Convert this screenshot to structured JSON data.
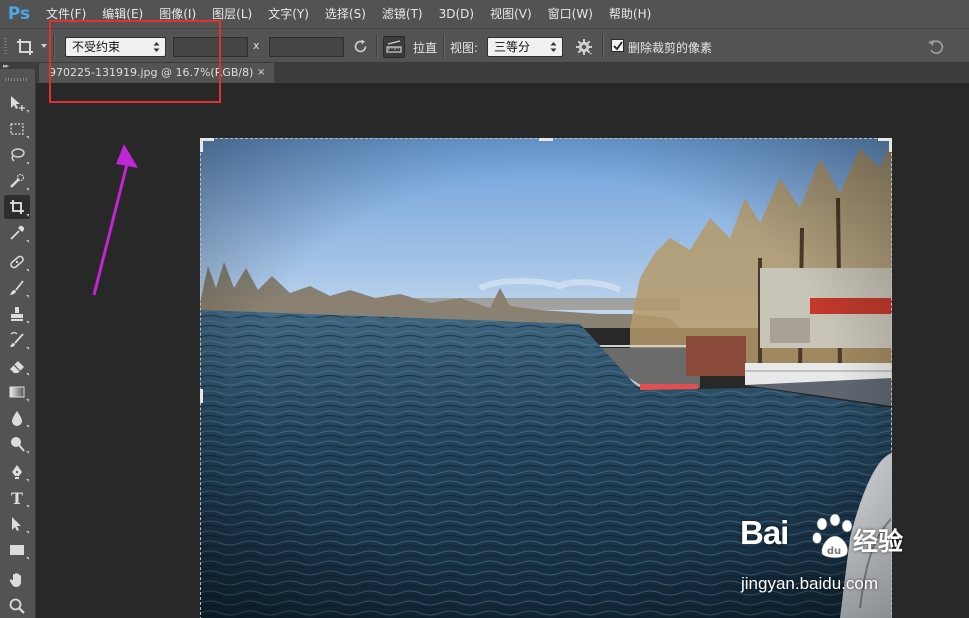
{
  "app": {
    "logo": "Ps"
  },
  "menu": [
    "文件(F)",
    "编辑(E)",
    "图像(I)",
    "图层(L)",
    "文字(Y)",
    "选择(S)",
    "滤镜(T)",
    "3D(D)",
    "视图(V)",
    "窗口(W)",
    "帮助(H)"
  ],
  "options": {
    "ratio_preset": "不受约束",
    "width_value": "",
    "height_value": "",
    "x_separator": "x",
    "straighten_label": "拉直",
    "view_label": "视图:",
    "view_preset": "三等分",
    "delete_cropped_label": "删除裁剪的像素",
    "delete_cropped_checked": true
  },
  "document_tab": {
    "title": "970225-131919.jpg @ 16.7%(RGB/8)",
    "close": "×"
  },
  "tools": [
    "move-tool",
    "marquee-tool",
    "lasso-tool",
    "quick-selection-tool",
    "crop-tool",
    "eyedropper-tool",
    "spot-healing-tool",
    "brush-tool",
    "clone-stamp-tool",
    "history-brush-tool",
    "eraser-tool",
    "gradient-tool",
    "blur-tool",
    "dodge-tool",
    "pen-tool",
    "type-tool",
    "path-selection-tool",
    "rectangle-tool",
    "hand-tool",
    "zoom-tool"
  ],
  "type_tool_glyph": "T",
  "annotation": {
    "box_color": "#e03030",
    "arrow_color": "#c026d3"
  },
  "watermark": {
    "brand": "Bai",
    "suffix": "经验",
    "url": "jingyan.baidu.com"
  },
  "colors": {
    "ui_panel": "#535353",
    "workspace": "#282828",
    "logo_blue": "#4aa8e6"
  }
}
